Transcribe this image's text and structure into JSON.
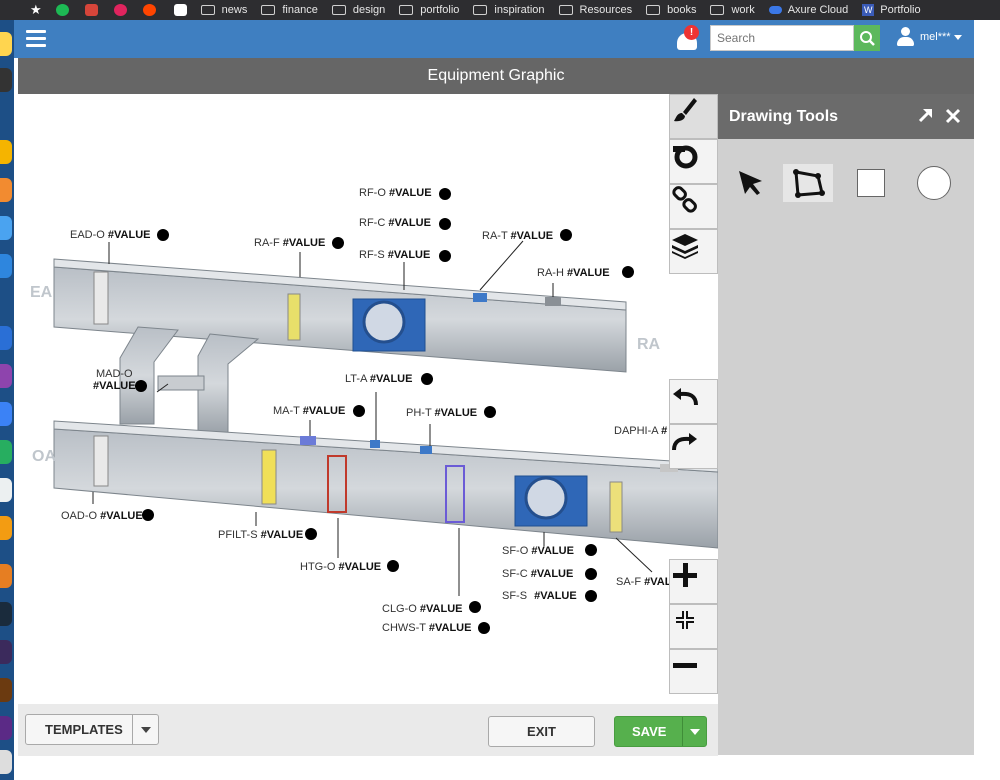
{
  "bookmarks": {
    "items": [
      "news",
      "finance",
      "design",
      "portfolio",
      "inspiration",
      "Resources",
      "books",
      "work",
      "Axure Cloud",
      "Portfolio"
    ]
  },
  "header": {
    "notification_count": "!",
    "search_placeholder": "Search",
    "user_name": "mel***"
  },
  "title": "Equipment Graphic",
  "zones": {
    "ea": "EA",
    "oa": "OA",
    "ra": "RA"
  },
  "points": [
    {
      "name": "RF-O",
      "value": "#VALUE"
    },
    {
      "name": "RF-C",
      "value": "#VALUE"
    },
    {
      "name": "RF-S",
      "value": "#VALUE"
    },
    {
      "name": "EAD-O",
      "value": "#VALUE"
    },
    {
      "name": "RA-F",
      "value": "#VALUE"
    },
    {
      "name": "RA-T",
      "value": "#VALUE"
    },
    {
      "name": "RA-H",
      "value": "#VALUE"
    },
    {
      "name": "MAD-O",
      "value": "#VALUE"
    },
    {
      "name": "LT-A",
      "value": "#VALUE"
    },
    {
      "name": "MA-T",
      "value": "#VALUE"
    },
    {
      "name": "PH-T",
      "value": "#VALUE"
    },
    {
      "name": "DAPHI-A",
      "value": "#"
    },
    {
      "name": "OAD-O",
      "value": "#VALUE"
    },
    {
      "name": "PFILT-S",
      "value": "#VALUE"
    },
    {
      "name": "HTG-O",
      "value": "#VALUE"
    },
    {
      "name": "SF-O",
      "value": "#VALUE"
    },
    {
      "name": "SF-C",
      "value": "#VALUE"
    },
    {
      "name": "SF-S",
      "value": "#VALUE"
    },
    {
      "name": "SA-F",
      "value": "#VAL"
    },
    {
      "name": "CLG-O",
      "value": "#VALUE"
    },
    {
      "name": "CHWS-T",
      "value": "#VALUE"
    }
  ],
  "drawing_tools": {
    "title": "Drawing Tools",
    "tools": [
      "pointer-icon",
      "polygon-icon",
      "rectangle-icon",
      "circle-icon"
    ]
  },
  "side_tools": [
    "brush-icon",
    "fan-icon",
    "link-icon",
    "layers-icon",
    "undo-icon",
    "redo-icon",
    "zoom-in-icon",
    "fit-icon",
    "zoom-out-icon"
  ],
  "footer": {
    "templates_label": "TEMPLATES",
    "exit_label": "EXIT",
    "save_label": "SAVE"
  },
  "colors": {
    "header_blue": "#3f7fc1",
    "title_grey": "#666666",
    "save_green": "#56b04d",
    "search_green": "#5cb85c"
  }
}
